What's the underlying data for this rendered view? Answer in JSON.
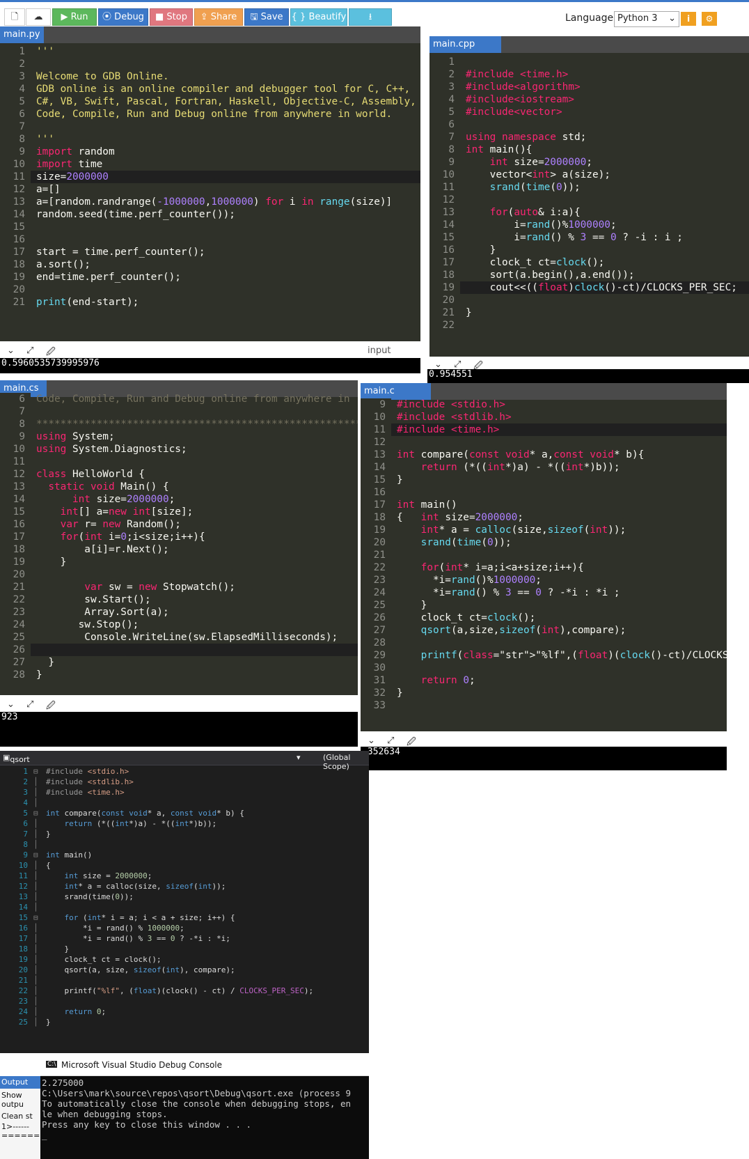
{
  "toolbar": {
    "run": "▶ Run",
    "debug": "⦿ Debug",
    "stop": "■ Stop",
    "share": "Share",
    "save": "Save",
    "beautify": "{ } Beautify",
    "download": "⭳",
    "language_label": "Language",
    "language_value": "Python 3"
  },
  "python": {
    "tab": "main.py",
    "output": "0.5960535739995976",
    "input_label": "input",
    "lines": [
      "'''",
      "",
      "Welcome to GDB Online.",
      "GDB online is an online compiler and debugger tool for C, C++,",
      "C#, VB, Swift, Pascal, Fortran, Haskell, Objective-C, Assembly,",
      "Code, Compile, Run and Debug online from anywhere in world.",
      "",
      "'''",
      "import random",
      "import time",
      "size=2000000",
      "a=[]",
      "a=[random.randrange(-1000000,1000000) for i in range(size)]",
      "random.seed(time.perf_counter());",
      "",
      "",
      "start = time.perf_counter();",
      "a.sort();",
      "end=time.perf_counter();",
      "",
      "print(end-start);"
    ]
  },
  "cpp": {
    "tab": "main.cpp",
    "output": "0.954551",
    "lines": [
      "",
      "#include <time.h>",
      "#include<algorithm>",
      "#include<iostream>",
      "#include<vector>",
      "",
      "using namespace std;",
      "int main(){",
      "    int size=2000000;",
      "    vector<int> a(size);",
      "    srand(time(0));",
      "",
      "    for(auto& i:a){",
      "        i=rand()%1000000;",
      "        i=rand() % 3 == 0 ? -i : i ;",
      "    }",
      "    clock_t ct=clock();",
      "    sort(a.begin(),a.end());",
      "    cout<<((float)clock()-ct)/CLOCKS_PER_SEC;",
      "",
      "}",
      ""
    ]
  },
  "cs": {
    "tab": "main.cs",
    "output": "923",
    "lines": [
      "Code, Compile, Run and Debug online from anywhere in",
      "",
      "*******************************************************",
      "using System;",
      "using System.Diagnostics;",
      "",
      "class HelloWorld {",
      "  static void Main() {",
      "      int size=2000000;",
      "    int[] a=new int[size];",
      "    var r= new Random();",
      "    for(int i=0;i<size;i++){",
      "        a[i]=r.Next();",
      "    }",
      "",
      "        var sw = new Stopwatch();",
      "        sw.Start();",
      "        Array.Sort(a);",
      "       sw.Stop();",
      "        Console.WriteLine(sw.ElapsedMilliseconds);",
      "",
      "  }",
      "}"
    ],
    "first_number": 6
  },
  "c": {
    "tab": "main.c",
    "output": ".352634",
    "lines": [
      "#include <stdio.h>",
      "#include <stdlib.h>",
      "#include <time.h>",
      "",
      "int compare(const void* a,const void* b){",
      "    return (*((int*)a) - *((int*)b));",
      "}",
      "",
      "int main()",
      "{   int size=2000000;",
      "    int* a = calloc(size,sizeof(int));",
      "    srand(time(0));",
      "",
      "    for(int* i=a;i<a+size;i++){",
      "      *i=rand()%1000000;",
      "      *i=rand() % 3 == 0 ? -*i : *i ;",
      "    }",
      "    clock_t ct=clock();",
      "    qsort(a,size,sizeof(int),compare);",
      "",
      "    printf(\"%lf\",(float)(clock()-ct)/CLOCKS_PER_SEC);",
      "",
      "    return 0;",
      "}",
      ""
    ],
    "first_number": 9
  },
  "vs": {
    "file_combo": "qsort",
    "scope_combo": "(Global Scope)",
    "lines": [
      "#include <stdio.h>",
      "#include <stdlib.h>",
      "#include <time.h>",
      "",
      "int compare(const void* a, const void* b) {",
      "    return (*((int*)a) - *((int*)b));",
      "}",
      "",
      "int main()",
      "{",
      "    int size = 2000000;",
      "    int* a = calloc(size, sizeof(int));",
      "    srand(time(0));",
      "",
      "    for (int* i = a; i < a + size; i++) {",
      "        *i = rand() % 1000000;",
      "        *i = rand() % 3 == 0 ? -*i : *i;",
      "    }",
      "    clock_t ct = clock();",
      "    qsort(a, size, sizeof(int), compare);",
      "",
      "    printf(\"%lf\", (float)(clock() - ct) / CLOCKS_PER_SEC);",
      "",
      "    return 0;",
      "}"
    ],
    "debug_title": "Microsoft Visual Studio Debug Console",
    "debug_lines": [
      "2.275000",
      "C:\\Users\\mark\\source\\repos\\qsort\\Debug\\qsort.exe (process 9",
      "To automatically close the console when debugging stops, en",
      "le when debugging stops.",
      "Press any key to close this window . . ."
    ],
    "output_tab": "Output",
    "output_show": "Show outpu",
    "output_clean": "Clean st",
    "output_dash1": "1>------",
    "output_dash2": "========"
  }
}
